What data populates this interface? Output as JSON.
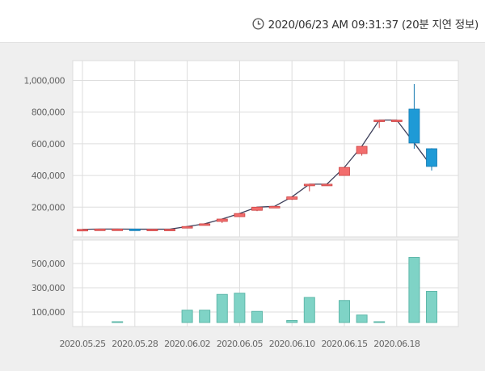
{
  "header": {
    "timestamp": "2020/06/23 AM 09:31:37 (20분 지연 정보)",
    "icon": "clock-icon"
  },
  "colors": {
    "up": "#f26d6d",
    "down": "#1e9ad6",
    "volume": "#7fd3c6",
    "line": "#3d3f5a"
  },
  "chart_data": [
    {
      "type": "candlestick",
      "title": "",
      "dates": [
        "2020.05.25",
        "2020.05.26",
        "2020.05.27",
        "2020.05.28",
        "2020.05.29",
        "2020.06.01",
        "2020.06.02",
        "2020.06.03",
        "2020.06.04",
        "2020.06.05",
        "2020.06.08",
        "2020.06.09",
        "2020.06.10",
        "2020.06.11",
        "2020.06.12",
        "2020.06.15",
        "2020.06.16",
        "2020.06.17",
        "2020.06.18",
        "2020.06.19",
        "2020.06.22"
      ],
      "x_tick_labels": [
        "2020.05.25",
        "2020.05.28",
        "2020.06.02",
        "2020.06.05",
        "2020.06.10",
        "2020.06.15",
        "2020.06.18"
      ],
      "x_tick_indices": [
        0,
        3,
        6,
        9,
        12,
        15,
        18
      ],
      "ohlc": [
        [
          59000,
          61000,
          59000,
          60000
        ],
        [
          61000,
          63000,
          61000,
          62000
        ],
        [
          61000,
          64000,
          61000,
          62000
        ],
        [
          62000,
          62000,
          61000,
          61000
        ],
        [
          61000,
          62000,
          61000,
          61000
        ],
        [
          61000,
          62000,
          61000,
          61000
        ],
        [
          76000,
          79000,
          76000,
          78000
        ],
        [
          93000,
          96000,
          93000,
          95000
        ],
        [
          110000,
          128000,
          100000,
          125000
        ],
        [
          140000,
          162000,
          138000,
          160000
        ],
        [
          180000,
          203000,
          175000,
          200000
        ],
        [
          205000,
          206000,
          204000,
          205000
        ],
        [
          250000,
          266000,
          245000,
          265000
        ],
        [
          345000,
          346000,
          300000,
          345000
        ],
        [
          345000,
          346000,
          344000,
          345000
        ],
        [
          400000,
          451000,
          398000,
          451000
        ],
        [
          538000,
          584000,
          525000,
          584000
        ],
        [
          748000,
          752000,
          700000,
          750000
        ],
        [
          750000,
          752000,
          748000,
          750000
        ],
        [
          819000,
          977000,
          569000,
          605000
        ],
        [
          569000,
          572000,
          431000,
          457000
        ]
      ],
      "y_ticks": [
        "200,000",
        "400,000",
        "600,000",
        "800,000",
        "1,000,000"
      ],
      "y_tick_values": [
        200000,
        400000,
        600000,
        800000,
        1000000
      ],
      "ylim": [
        0,
        1100000
      ],
      "grid": true
    },
    {
      "type": "bar",
      "title": "Volume",
      "values": [
        0,
        0,
        20000,
        0,
        0,
        0,
        115000,
        115000,
        245000,
        255000,
        105000,
        0,
        30000,
        220000,
        0,
        195000,
        75000,
        20000,
        0,
        550000,
        270000
      ],
      "y_ticks": [
        "100,000",
        "300,000",
        "500,000"
      ],
      "y_tick_values": [
        100000,
        300000,
        500000
      ],
      "ylim": [
        0,
        690000
      ],
      "grid": true
    }
  ]
}
